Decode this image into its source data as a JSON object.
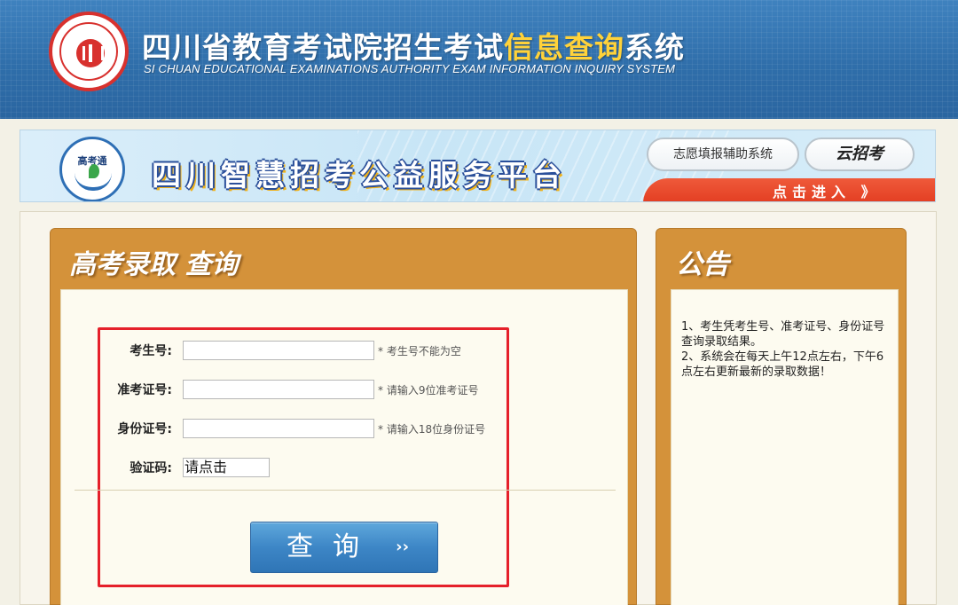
{
  "header": {
    "title_main": "四川省教育考试院招生考试",
    "title_highlight": "信息查询",
    "title_tail": "系统",
    "subtitle": "SI CHUAN EDUCATIONAL EXAMINATIONS AUTHORITY EXAM INFORMATION INQUIRY SYSTEM",
    "logo_icon": "exam-authority-seal-icon"
  },
  "banner": {
    "badge_label": "高考通",
    "platform_name": "四川智慧招考公益服务平台",
    "button_1": "志愿填报辅助系统",
    "button_2": "云招考",
    "enter_label": "点击进入 》"
  },
  "query_panel": {
    "title": "高考录取  查询",
    "fields": [
      {
        "label": "考生号:",
        "value": "",
        "hint": "* 考生号不能为空"
      },
      {
        "label": "准考证号:",
        "value": "",
        "hint": "* 请输入9位准考证号"
      },
      {
        "label": "身份证号:",
        "value": "",
        "hint": "* 请输入18位身份证号"
      }
    ],
    "captcha_label": "验证码:",
    "captcha_value": "请点击",
    "submit_label": "查询",
    "submit_arrows": "››"
  },
  "notice_panel": {
    "title": "公告",
    "items": [
      "1、考生凭考生号、准考证号、身份证号查询录取结果。",
      "2、系统会在每天上午12点左右，下午6点左右更新最新的录取数据！"
    ]
  },
  "colors": {
    "header_blue": "#2f6eaa",
    "panel_orange": "#d4923a",
    "highlight_yellow": "#ffd23a",
    "red_outline": "#e5202a",
    "button_blue": "#3d86c6"
  }
}
